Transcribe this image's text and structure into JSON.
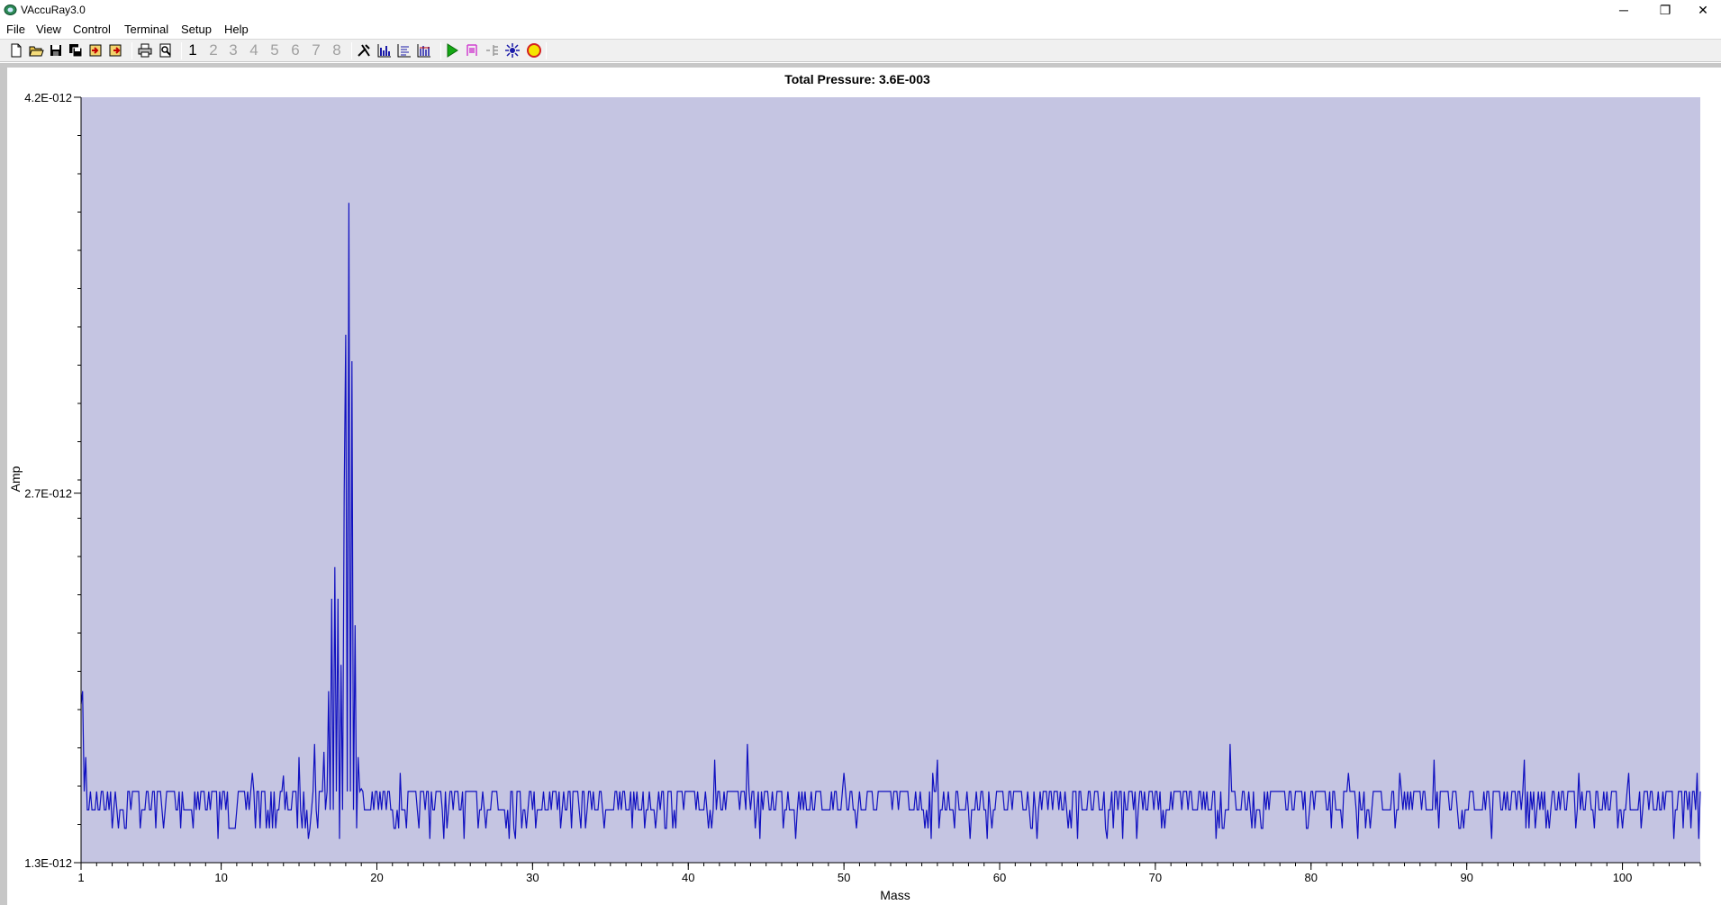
{
  "window": {
    "title": "VAccuRay3.0",
    "buttons": {
      "minimize": "─",
      "restore": "❐",
      "close": "✕"
    }
  },
  "menu": [
    "File",
    "View",
    "Control",
    "Terminal",
    "Setup",
    "Help"
  ],
  "toolbar": {
    "file_icons": [
      "new-file-icon",
      "open-folder-icon",
      "save-icon",
      "save-all-icon",
      "import-icon",
      "export-icon"
    ],
    "print_icons": [
      "print-icon",
      "print-preview-icon"
    ],
    "channels": [
      "1",
      "2",
      "3",
      "4",
      "5",
      "6",
      "7",
      "8"
    ],
    "active_channel": "1",
    "view_icons": [
      "tools-icon",
      "bar-chart-icon",
      "list-chart-icon",
      "trend-chart-icon"
    ],
    "run_icons": [
      "play-icon",
      "mass-marker-icon",
      "scan-range-icon",
      "settings-sun-icon",
      "status-indicator-icon"
    ]
  },
  "chart_data": {
    "type": "line",
    "title": "Total Pressure: 3.6E-003",
    "xlabel": "Mass",
    "ylabel": "Amp",
    "xlim": [
      1,
      105
    ],
    "ylim": [
      1.3e-12,
      4.2e-12
    ],
    "xticks": [
      "1",
      "10",
      "20",
      "30",
      "40",
      "50",
      "60",
      "70",
      "80",
      "90",
      "100"
    ],
    "yticks": [
      "1.3E-012",
      "2.7E-012",
      "4.2E-012"
    ],
    "grid": false,
    "colors": {
      "plot_bg": "#c5c5e2",
      "line": "#1010c0"
    },
    "baseline": 1.57e-12,
    "noise_dips": [
      1.5e-12,
      1.43e-12,
      1.39e-12
    ],
    "peaks": [
      {
        "mass": 1.1,
        "value": 1.95e-12
      },
      {
        "mass": 2.0,
        "value": 1.57e-12
      },
      {
        "mass": 12.0,
        "value": 1.64e-12
      },
      {
        "mass": 14.0,
        "value": 1.63e-12
      },
      {
        "mass": 15.0,
        "value": 1.7e-12
      },
      {
        "mass": 16.0,
        "value": 1.75e-12
      },
      {
        "mass": 17.3,
        "value": 2.42e-12
      },
      {
        "mass": 17.7,
        "value": 2.05e-12
      },
      {
        "mass": 18.2,
        "value": 3.8e-12
      },
      {
        "mass": 19.0,
        "value": 1.58e-12
      },
      {
        "mass": 21.5,
        "value": 1.64e-12
      },
      {
        "mass": 41.7,
        "value": 1.69e-12
      },
      {
        "mass": 43.8,
        "value": 1.75e-12
      },
      {
        "mass": 50.0,
        "value": 1.64e-12
      },
      {
        "mass": 55.7,
        "value": 1.64e-12
      },
      {
        "mass": 56.0,
        "value": 1.69e-12
      },
      {
        "mass": 74.8,
        "value": 1.75e-12
      },
      {
        "mass": 82.4,
        "value": 1.64e-12
      },
      {
        "mass": 85.7,
        "value": 1.64e-12
      },
      {
        "mass": 87.9,
        "value": 1.69e-12
      },
      {
        "mass": 93.7,
        "value": 1.69e-12
      },
      {
        "mass": 97.2,
        "value": 1.64e-12
      },
      {
        "mass": 100.4,
        "value": 1.64e-12
      },
      {
        "mass": 104.8,
        "value": 1.64e-12
      }
    ]
  }
}
